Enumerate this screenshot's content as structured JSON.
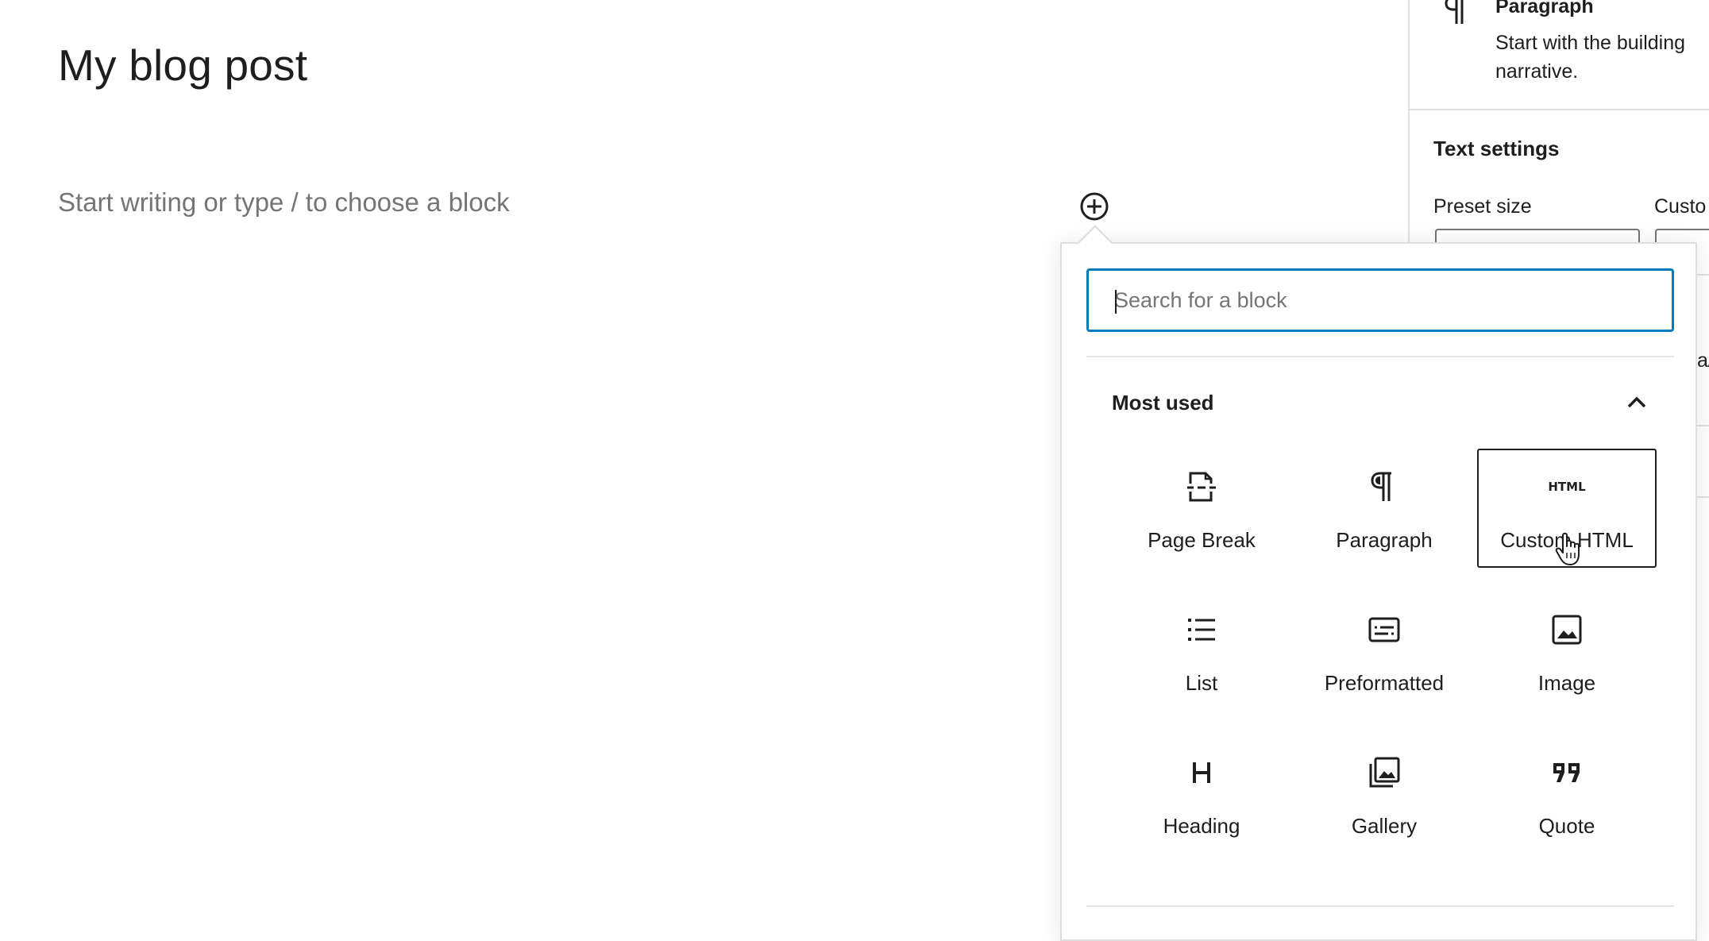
{
  "editor": {
    "post_title": "My blog post",
    "placeholder": "Start writing or type / to choose a block"
  },
  "inserter": {
    "search_placeholder": "Search for a block",
    "section_title": "Most used",
    "blocks": [
      {
        "label": "Page Break",
        "icon": "page-break-icon"
      },
      {
        "label": "Paragraph",
        "icon": "paragraph-icon"
      },
      {
        "label": "Custom HTML",
        "icon": "html-icon",
        "icon_text": "HTML",
        "selected": true
      },
      {
        "label": "List",
        "icon": "list-icon"
      },
      {
        "label": "Preformatted",
        "icon": "preformatted-icon"
      },
      {
        "label": "Image",
        "icon": "image-icon"
      },
      {
        "label": "Heading",
        "icon": "heading-icon"
      },
      {
        "label": "Gallery",
        "icon": "gallery-icon"
      },
      {
        "label": "Quote",
        "icon": "quote-icon"
      }
    ]
  },
  "sidebar": {
    "block_name": "Paragraph",
    "block_description": "Start with the building narrative.",
    "text_settings_title": "Text settings",
    "preset_size_label": "Preset size",
    "custom_label": "Custo",
    "fragment": "a/"
  },
  "colors": {
    "accent": "#007cba",
    "text": "#1e1e1e",
    "muted": "#757575",
    "border": "#dddddd"
  }
}
